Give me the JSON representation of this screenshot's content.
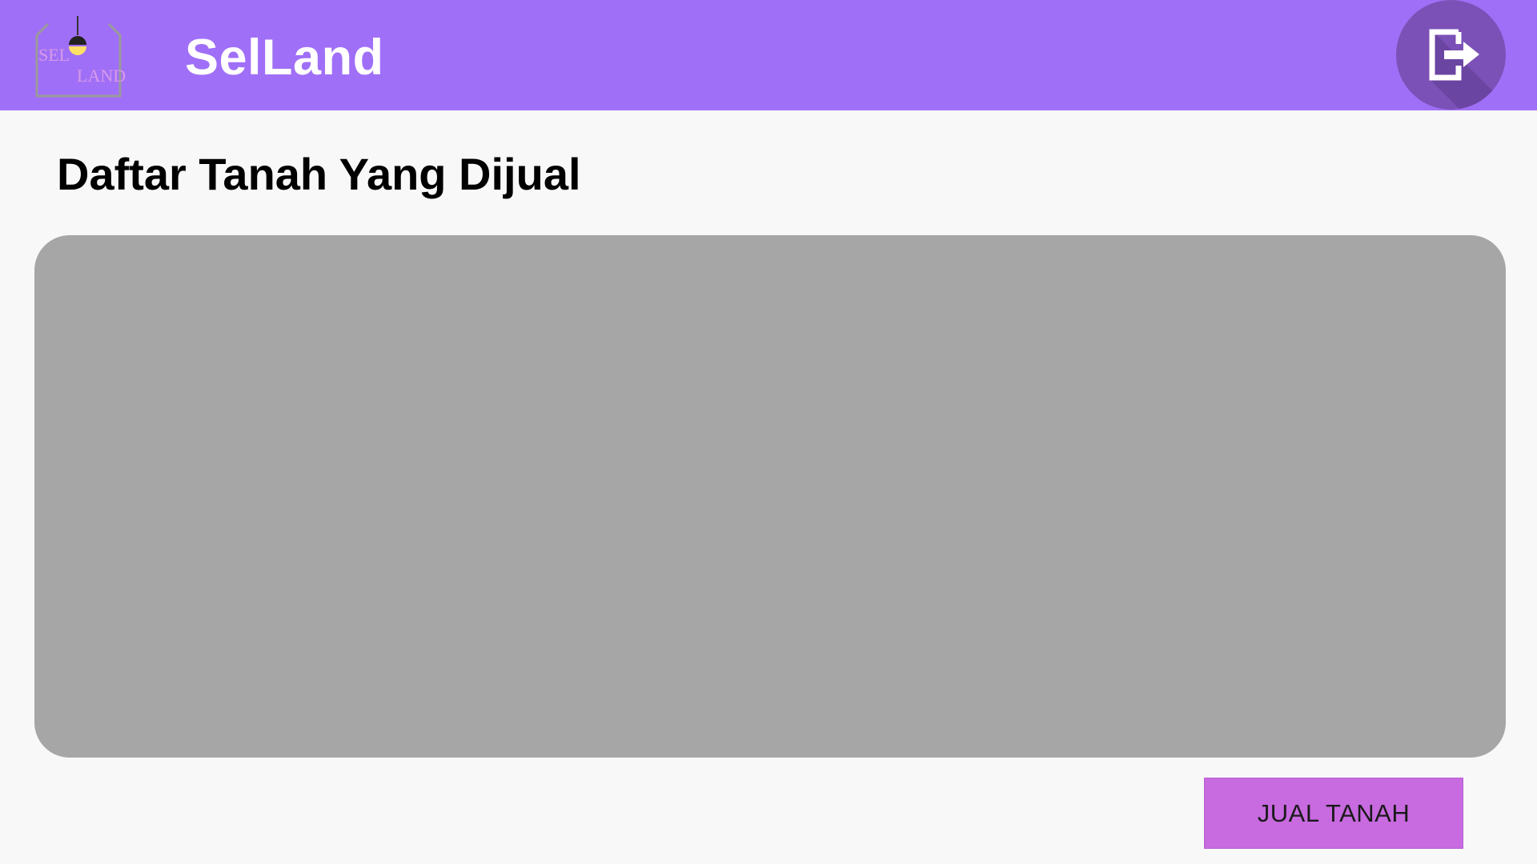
{
  "header": {
    "logo": {
      "icon": "selland-logo-icon",
      "line1": "SEL",
      "line2": "LAND"
    },
    "app_title": "SelLand",
    "logout": {
      "icon": "logout-icon"
    }
  },
  "main": {
    "page_title": "Daftar Tanah Yang Dijual",
    "sell_button_label": "JUAL TANAH"
  },
  "colors": {
    "header": "#a06ff7",
    "logout_circle": "#7b51b7",
    "list_panel": "#a6a6a6",
    "sell_button": "#c86ae0",
    "page_background": "#f8f8f8"
  }
}
